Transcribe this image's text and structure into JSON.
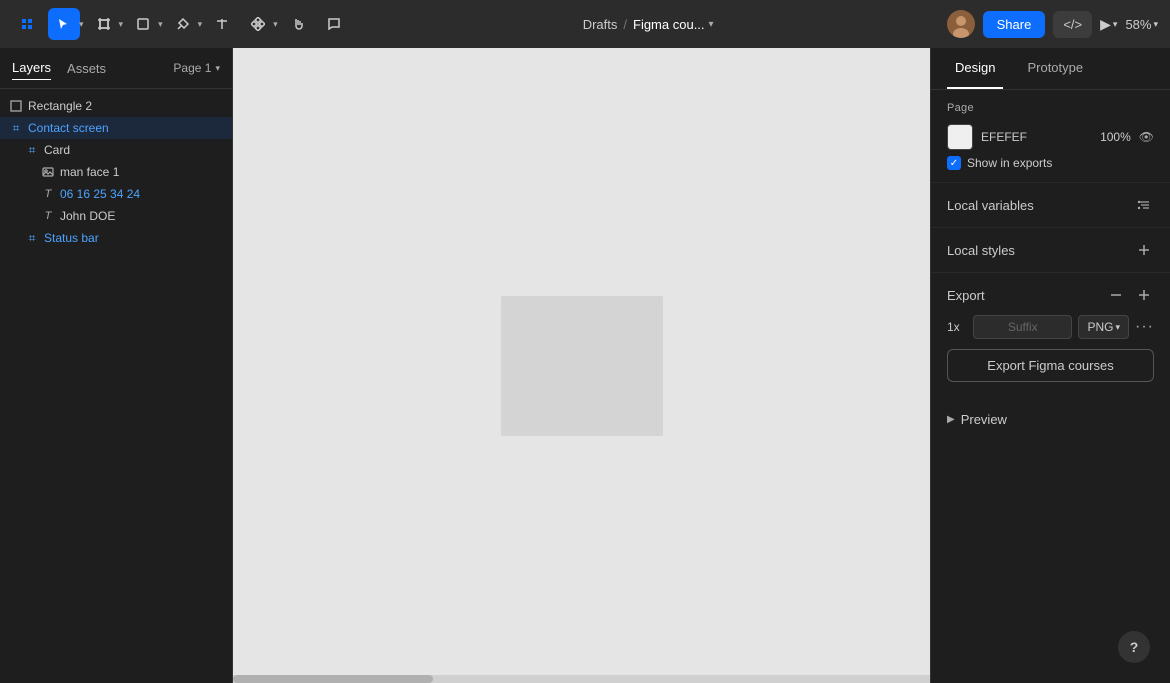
{
  "toolbar": {
    "breadcrumb_drafts": "Drafts",
    "breadcrumb_sep": "/",
    "breadcrumb_current": "Figma cou...",
    "share_label": "Share",
    "zoom_level": "58%"
  },
  "left_panel": {
    "tab_layers": "Layers",
    "tab_assets": "Assets",
    "page_label": "Page 1",
    "layers": [
      {
        "id": "rectangle2",
        "label": "Rectangle 2",
        "icon": "□",
        "indent": 0,
        "type": "shape"
      },
      {
        "id": "contact-screen",
        "label": "Contact screen",
        "icon": "+",
        "indent": 0,
        "type": "frame",
        "selected": true
      },
      {
        "id": "card",
        "label": "Card",
        "icon": "+",
        "indent": 1,
        "type": "frame"
      },
      {
        "id": "man-face",
        "label": "man face 1",
        "icon": "⬚",
        "indent": 2,
        "type": "image"
      },
      {
        "id": "phone-number",
        "label": "06 16 25 34 24",
        "icon": "T",
        "indent": 2,
        "type": "text",
        "color": "blue"
      },
      {
        "id": "name",
        "label": "John DOE",
        "icon": "T",
        "indent": 2,
        "type": "text"
      },
      {
        "id": "status-bar",
        "label": "Status bar",
        "icon": "+",
        "indent": 1,
        "type": "frame",
        "color": "blue"
      }
    ]
  },
  "right_panel": {
    "tab_design": "Design",
    "tab_prototype": "Prototype",
    "page_section": {
      "title": "Page",
      "color_hex": "EFEFEF",
      "opacity": "100%",
      "show_in_exports": "Show in exports"
    },
    "local_variables": {
      "title": "Local variables"
    },
    "local_styles": {
      "title": "Local styles"
    },
    "export_section": {
      "title": "Export",
      "scale": "1x",
      "suffix_placeholder": "Suffix",
      "format": "PNG",
      "export_button_label": "Export Figma courses"
    },
    "preview": {
      "label": "Preview"
    }
  },
  "help": {
    "label": "?"
  }
}
